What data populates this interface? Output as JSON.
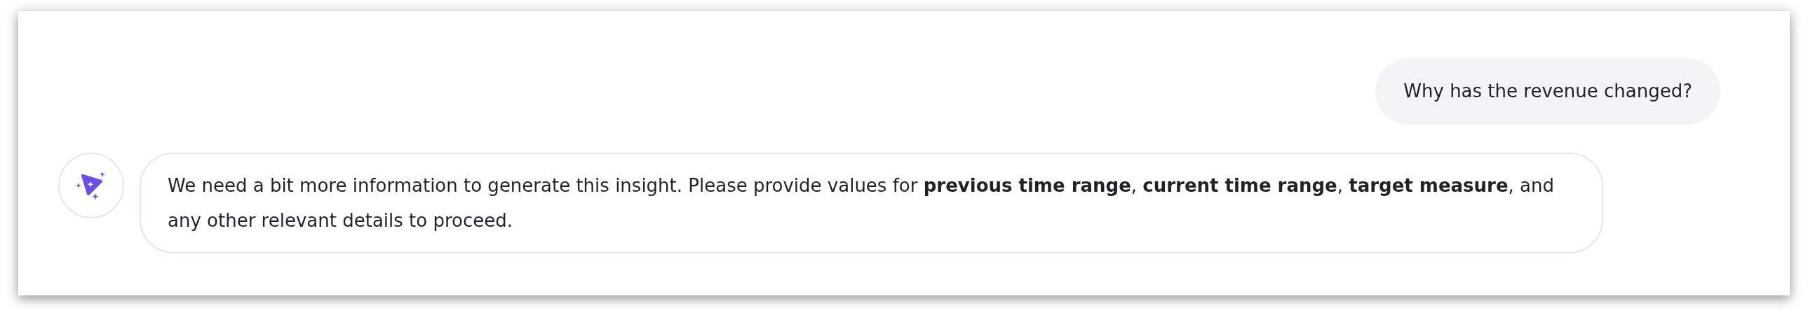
{
  "messages": [
    {
      "kind": "user",
      "text": "Why has the revenue changed?"
    },
    {
      "kind": "assistant",
      "text": "We need a bit more information to generate this insight. Please provide values for **previous time range**, **current time range**, **target measure**, and any other relevant details to proceed."
    }
  ]
}
